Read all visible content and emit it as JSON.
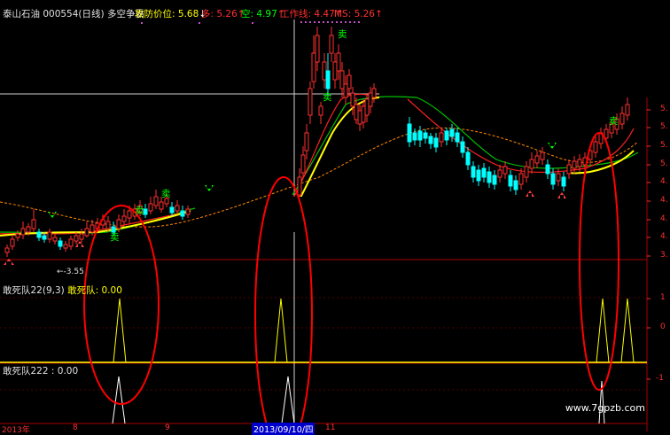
{
  "header": {
    "stock": "泰山石油 000554(日线) 多空争霸",
    "attack_label": "攻防价位:",
    "attack_value": "5.68",
    "duo_label": "多:",
    "duo_value": "5.26",
    "kong_label": "空:",
    "kong_value": "4.97",
    "work_label": "工作线:",
    "work_value": "4.47",
    "ms_label": "MS:",
    "ms_value": "5.26"
  },
  "panel1": {
    "title": "敢死队22(9,3)",
    "sub_label": "敢死队:",
    "sub_value": "0.00"
  },
  "panel2": {
    "title": "敢死队222",
    "value": "0.00"
  },
  "price_axis": [
    "5.",
    "5.",
    "5.",
    "5.",
    "4.",
    "4.",
    "4.",
    "4.",
    "3."
  ],
  "panel1_axis": [
    "1",
    "0"
  ],
  "panel2_axis": [
    "-1"
  ],
  "date_labels": {
    "left": "2013年",
    "m8": "8",
    "m9": "9",
    "m11": "11",
    "cursor_date": "2013/09/10/四"
  },
  "low_price_label": "←-3.55",
  "signal_sell": "卖",
  "watermark": "www.7gpzb.com",
  "colors": {
    "up": "#ff3030",
    "down": "#00ffff",
    "yellow": "#ffff00",
    "green": "#00c000",
    "orange": "#ff8800",
    "ellipse": "#ff0000"
  }
}
